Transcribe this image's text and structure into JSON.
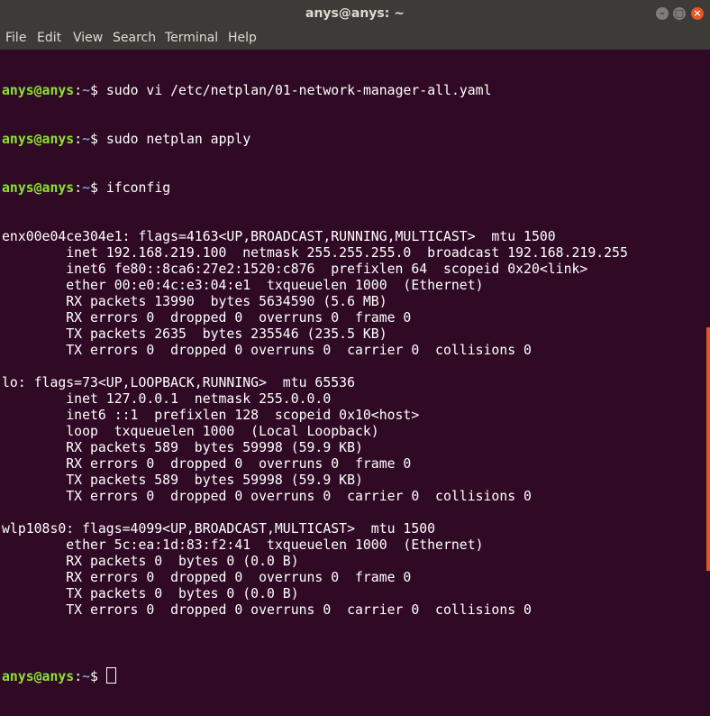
{
  "window": {
    "title": "anys@anys: ~"
  },
  "menu": [
    "File",
    "Edit",
    "View",
    "Search",
    "Terminal",
    "Help"
  ],
  "prompt": {
    "user": "anys@anys",
    "path": "~",
    "symbol": "$"
  },
  "commands": [
    "sudo vi /etc/netplan/01-network-manager-all.yaml",
    "sudo netplan apply",
    "ifconfig"
  ],
  "output": [
    "enx00e04ce304e1: flags=4163<UP,BROADCAST,RUNNING,MULTICAST>  mtu 1500",
    "        inet 192.168.219.100  netmask 255.255.255.0  broadcast 192.168.219.255",
    "        inet6 fe80::8ca6:27e2:1520:c876  prefixlen 64  scopeid 0x20<link>",
    "        ether 00:e0:4c:e3:04:e1  txqueuelen 1000  (Ethernet)",
    "        RX packets 13990  bytes 5634590 (5.6 MB)",
    "        RX errors 0  dropped 0  overruns 0  frame 0",
    "        TX packets 2635  bytes 235546 (235.5 KB)",
    "        TX errors 0  dropped 0 overruns 0  carrier 0  collisions 0",
    "",
    "lo: flags=73<UP,LOOPBACK,RUNNING>  mtu 65536",
    "        inet 127.0.0.1  netmask 255.0.0.0",
    "        inet6 ::1  prefixlen 128  scopeid 0x10<host>",
    "        loop  txqueuelen 1000  (Local Loopback)",
    "        RX packets 589  bytes 59998 (59.9 KB)",
    "        RX errors 0  dropped 0  overruns 0  frame 0",
    "        TX packets 589  bytes 59998 (59.9 KB)",
    "        TX errors 0  dropped 0 overruns 0  carrier 0  collisions 0",
    "",
    "wlp108s0: flags=4099<UP,BROADCAST,MULTICAST>  mtu 1500",
    "        ether 5c:ea:1d:83:f2:41  txqueuelen 1000  (Ethernet)",
    "        RX packets 0  bytes 0 (0.0 B)",
    "        RX errors 0  dropped 0  overruns 0  frame 0",
    "        TX packets 0  bytes 0 (0.0 B)",
    "        TX errors 0  dropped 0 overruns 0  carrier 0  collisions 0",
    ""
  ],
  "colors": {
    "background": "#300a24",
    "prompt_user": "#8ae234",
    "prompt_path": "#729fcf",
    "text": "#ffffff",
    "accent": "#e95420"
  },
  "icons": {
    "minimize": "minimize-icon",
    "maximize": "maximize-icon",
    "close": "close-icon"
  }
}
